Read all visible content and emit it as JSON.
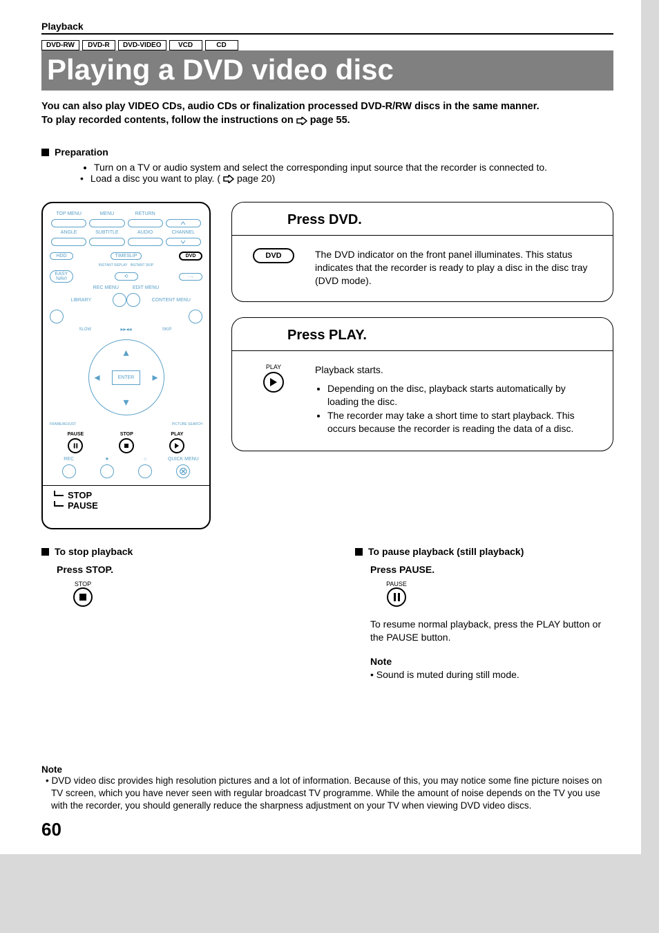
{
  "header": {
    "section": "Playback"
  },
  "badges": [
    "DVD-RW",
    "DVD-R",
    "DVD-VIDEO",
    "VCD",
    "CD"
  ],
  "title": "Playing a DVD video disc",
  "intro": {
    "line1": "You can also play VIDEO CDs, audio CDs or finalization processed DVD-R/RW discs in the same manner.",
    "line2a": "To play recorded contents, follow the instructions on",
    "line2b": "page 55."
  },
  "prep": {
    "heading": "Preparation",
    "items": [
      "Turn on a TV or audio system and select the corresponding input source that the recorder is connected to.",
      "Load a disc you want to play. (",
      "page 20)"
    ]
  },
  "remote": {
    "row1": [
      "TOP MENU",
      "MENU",
      "RETURN"
    ],
    "row2": [
      "ANGLE",
      "SUBTITLE",
      "AUDIO",
      "CHANNEL"
    ],
    "row3": {
      "hdd": "HDD",
      "timeslip": "TIMESLIP",
      "dvd": "DVD"
    },
    "row4": {
      "easy": "EASY\nNAVI",
      "ir": "INSTANT REPLAY",
      "is": "INSTANT SKIP"
    },
    "row5": {
      "rec": "REC MENU",
      "edit": "EDIT MENU"
    },
    "row6": {
      "lib": "LIBRARY",
      "cont": "CONTENT MENU"
    },
    "slow": "SLOW",
    "skip": "SKIP",
    "enter": "ENTER",
    "frame": "FRAME/ADJUST",
    "picture": "PICTURE SEARCH",
    "play_lbl": "PLAY",
    "stop_lbl": "STOP",
    "pause_lbl": "PAUSE",
    "rec_lbl": "REC",
    "quick_lbl": "QUICK MENU",
    "stop_big": "STOP",
    "pause_big": "PAUSE"
  },
  "step1": {
    "title": "Press DVD.",
    "btn": "DVD",
    "text": "The DVD indicator on the front panel illuminates. This status indicates that the recorder is ready to play a disc in the disc tray (DVD mode)."
  },
  "step2": {
    "title": "Press PLAY.",
    "lbl": "PLAY",
    "lead": "Playback starts.",
    "bullets": [
      "Depending on the disc, playback starts automatically by loading the disc.",
      "The recorder may take a short time to start playback. This occurs because the recorder is reading the data of a disc."
    ]
  },
  "stop": {
    "heading": "To stop playback",
    "sub": "Press STOP.",
    "lbl": "STOP"
  },
  "pause": {
    "heading": "To pause playback (still playback)",
    "sub": "Press PAUSE.",
    "lbl": "PAUSE",
    "resume": "To resume normal playback, press the PLAY button or the PAUSE button.",
    "note_head": "Note",
    "note_body": "• Sound is muted during still mode."
  },
  "footnote": {
    "head": "Note",
    "body": "• DVD video disc provides high resolution pictures and a lot of information. Because of this, you may notice some fine picture noises on TV screen, which you have never seen with regular broadcast TV programme. While the amount of noise depends on the TV you use with the recorder, you should generally reduce the sharpness adjustment on your TV when viewing DVD video discs."
  },
  "page_number": "60"
}
